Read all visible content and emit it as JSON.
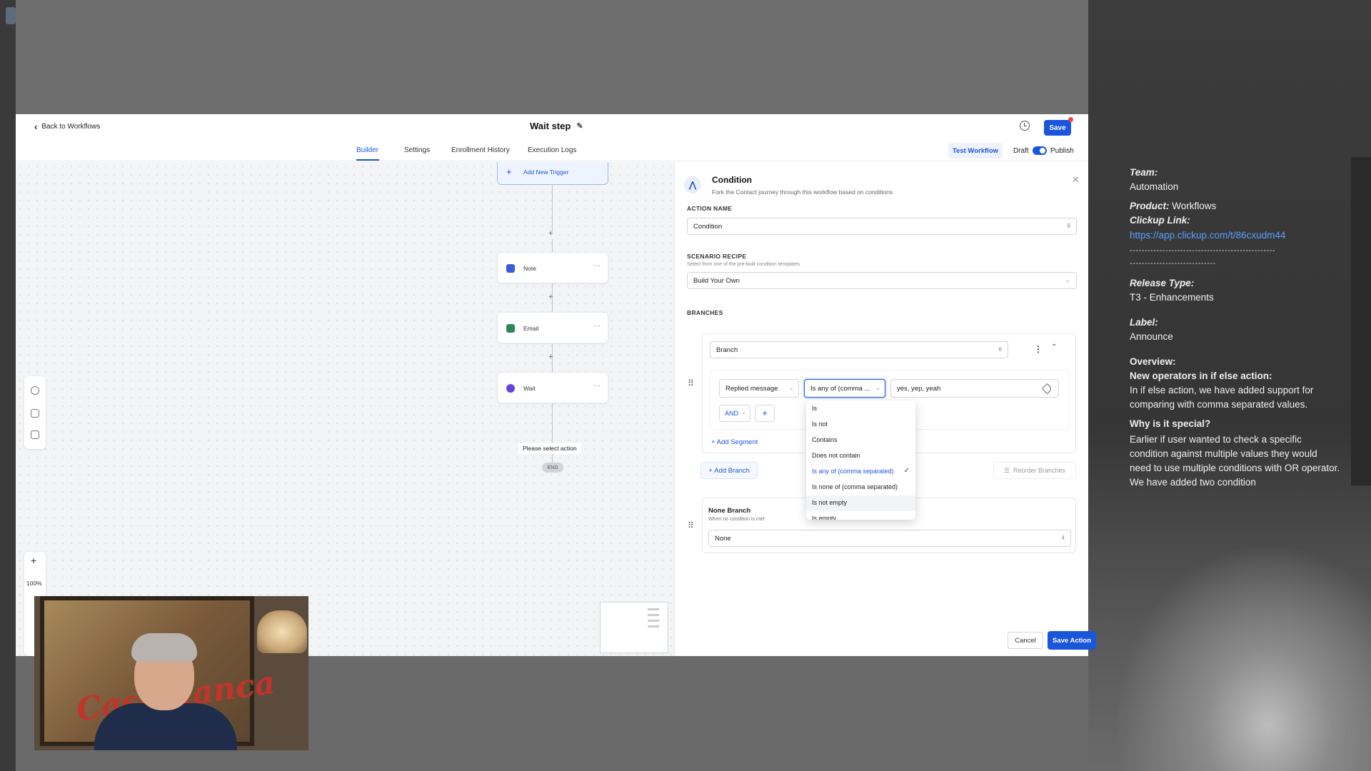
{
  "app": {
    "back_label": "Back to Workflows",
    "title": "Wait step",
    "save_label": "Save"
  },
  "tabs": [
    {
      "label": "Builder",
      "active": true
    },
    {
      "label": "Settings",
      "active": false
    },
    {
      "label": "Enrollment History",
      "active": false
    },
    {
      "label": "Execution Logs",
      "active": false
    }
  ],
  "header_actions": {
    "test_label": "Test Workflow",
    "draft_label": "Draft",
    "publish_label": "Publish",
    "publish_on": true
  },
  "canvas": {
    "trigger_label": "Add New Trigger",
    "nodes": [
      {
        "label": "Note",
        "icon": "note-icon",
        "color": "#3b5bdb"
      },
      {
        "label": "Email",
        "icon": "email-icon",
        "color": "#2f855a"
      },
      {
        "label": "Wait",
        "icon": "clock-icon",
        "color": "#6741d9"
      }
    ],
    "please_select": "Please select action",
    "end_label": "END",
    "zoom_level": "100%"
  },
  "panel": {
    "title": "Condition",
    "subtitle": "Fork the Contact journey through this workflow based on conditions",
    "action_name_label": "ACTION NAME",
    "action_name_value": "Condition",
    "action_name_count": "9",
    "recipe_label": "SCENARIO RECIPE",
    "recipe_sub": "Select from one of the pre-built condition templates",
    "recipe_value": "Build Your Own",
    "branches_label": "BRANCHES",
    "branch": {
      "name": "Branch",
      "count": "6",
      "field": "Replied message",
      "operator": "Is any of (comma ...",
      "value": "yes, yep, yeah",
      "and_label": "AND"
    },
    "add_segment": "Add Segment",
    "add_branch": "Add Branch",
    "reorder": "Reorder Branches",
    "none_branch": {
      "title": "None Branch",
      "sub": "When no condition is met",
      "value": "None",
      "count": "4"
    },
    "cancel": "Cancel",
    "save_action": "Save Action"
  },
  "operator_options": [
    {
      "label": "Is"
    },
    {
      "label": "Is not"
    },
    {
      "label": "Contains"
    },
    {
      "label": "Does not contain"
    },
    {
      "label": "Is any of (comma separated)",
      "selected": true
    },
    {
      "label": "Is none of (comma separated)"
    },
    {
      "label": "Is not empty"
    },
    {
      "label": "Is empty"
    }
  ],
  "notes": {
    "team_label": "Team:",
    "team_value": "Automation",
    "product_label": "Product:",
    "product_value": "Workflows",
    "clickup_label": "Clickup Link:",
    "clickup_url": "https://app.clickup.com/t/86cxudm44",
    "dashes1": "-------------------------------------------------",
    "dashes2": "-----------------------------",
    "release_label": "Release Type:",
    "release_value": "T3 - Enhancements",
    "label_label": "Label:",
    "label_value": "Announce",
    "overview_label": "Overview:",
    "overview_heading": "New operators in if else action:",
    "overview_text": "In if else action, we have added support for comparing with comma separated values.",
    "why_heading": "Why is it special?",
    "why_text": "Earlier if user wanted to check a specific condition against multiple values they would need to use multiple conditions with OR operator. We have added two condition"
  },
  "colors": {
    "accent": "#1a56db",
    "danger_dot": "#ef4444",
    "poster_text": "#c2342b"
  }
}
